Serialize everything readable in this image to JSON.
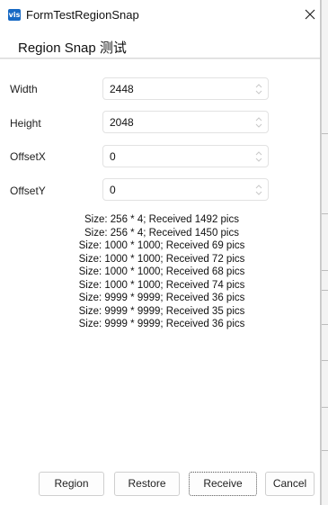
{
  "window": {
    "title": "FormTestRegionSnap",
    "app_icon_text": "vis",
    "subtitle": "Region Snap 测试"
  },
  "fields": [
    {
      "label": "Width",
      "value": "2448"
    },
    {
      "label": "Height",
      "value": "2048"
    },
    {
      "label": "OffsetX",
      "value": "0"
    },
    {
      "label": "OffsetY",
      "value": "0"
    }
  ],
  "log": [
    "Size: 256 * 4; Received 1492 pics",
    "Size: 256 * 4; Received 1450 pics",
    "Size: 1000 * 1000; Received 69 pics",
    "Size: 1000 * 1000; Received 72 pics",
    "Size: 1000 * 1000; Received 68 pics",
    "Size: 1000 * 1000; Received 74 pics",
    "Size: 9999 * 9999; Received 36 pics",
    "Size: 9999 * 9999; Received 35 pics",
    "Size: 9999 * 9999; Received 36 pics"
  ],
  "buttons": {
    "region": "Region",
    "restore": "Restore",
    "receive": "Receive",
    "cancel": "Cancel"
  },
  "icons": {
    "close": "close-icon",
    "spinner": "spinner-arrows-icon"
  }
}
